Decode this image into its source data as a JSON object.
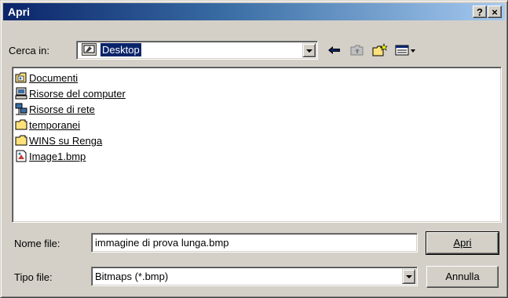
{
  "window": {
    "title": "Apri",
    "help_button": "?",
    "close_button": "×"
  },
  "lookin": {
    "label": "Cerca in:",
    "value": "Desktop"
  },
  "toolbar": {
    "back": "back-icon",
    "up": "up-folder-icon",
    "new_folder": "new-folder-icon",
    "view": "view-menu-icon"
  },
  "files": [
    {
      "name": "Documenti",
      "icon": "my-documents-icon"
    },
    {
      "name": "Risorse del computer",
      "icon": "my-computer-icon"
    },
    {
      "name": "Risorse di rete",
      "icon": "network-icon"
    },
    {
      "name": "temporanei",
      "icon": "folder-icon"
    },
    {
      "name": "WINS su Renga",
      "icon": "folder-icon"
    },
    {
      "name": "Image1.bmp",
      "icon": "bitmap-file-icon"
    }
  ],
  "filename": {
    "label": "Nome file:",
    "value": "immagine di prova lunga.bmp"
  },
  "filetype": {
    "label": "Tipo file:",
    "value": "Bitmaps (*.bmp)"
  },
  "buttons": {
    "open": "Apri",
    "cancel": "Annulla"
  }
}
